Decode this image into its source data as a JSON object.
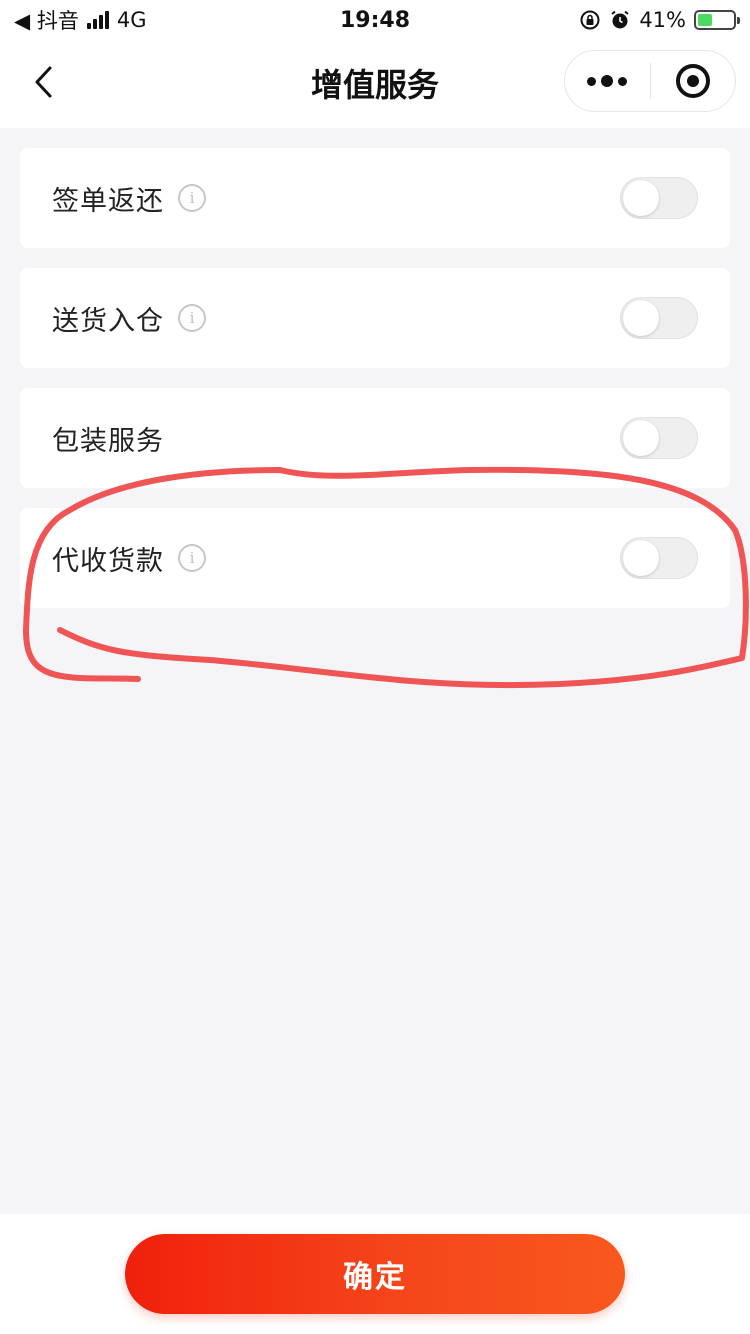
{
  "status_bar": {
    "back_app": "◀ 抖音",
    "network": "4G",
    "time": "19:48",
    "battery": "41%",
    "battery_level": 0.41
  },
  "nav": {
    "title": "增值服务"
  },
  "services": [
    {
      "label": "签单返还",
      "has_info": true,
      "enabled": false
    },
    {
      "label": "送货入仓",
      "has_info": true,
      "enabled": false
    },
    {
      "label": "包装服务",
      "has_info": false,
      "enabled": false
    },
    {
      "label": "代收货款",
      "has_info": true,
      "enabled": false
    }
  ],
  "info_glyph": "i",
  "confirm_button": "确定",
  "colors": {
    "accent": "#f5461a",
    "annotation": "#f05555",
    "background": "#f5f5f7"
  }
}
